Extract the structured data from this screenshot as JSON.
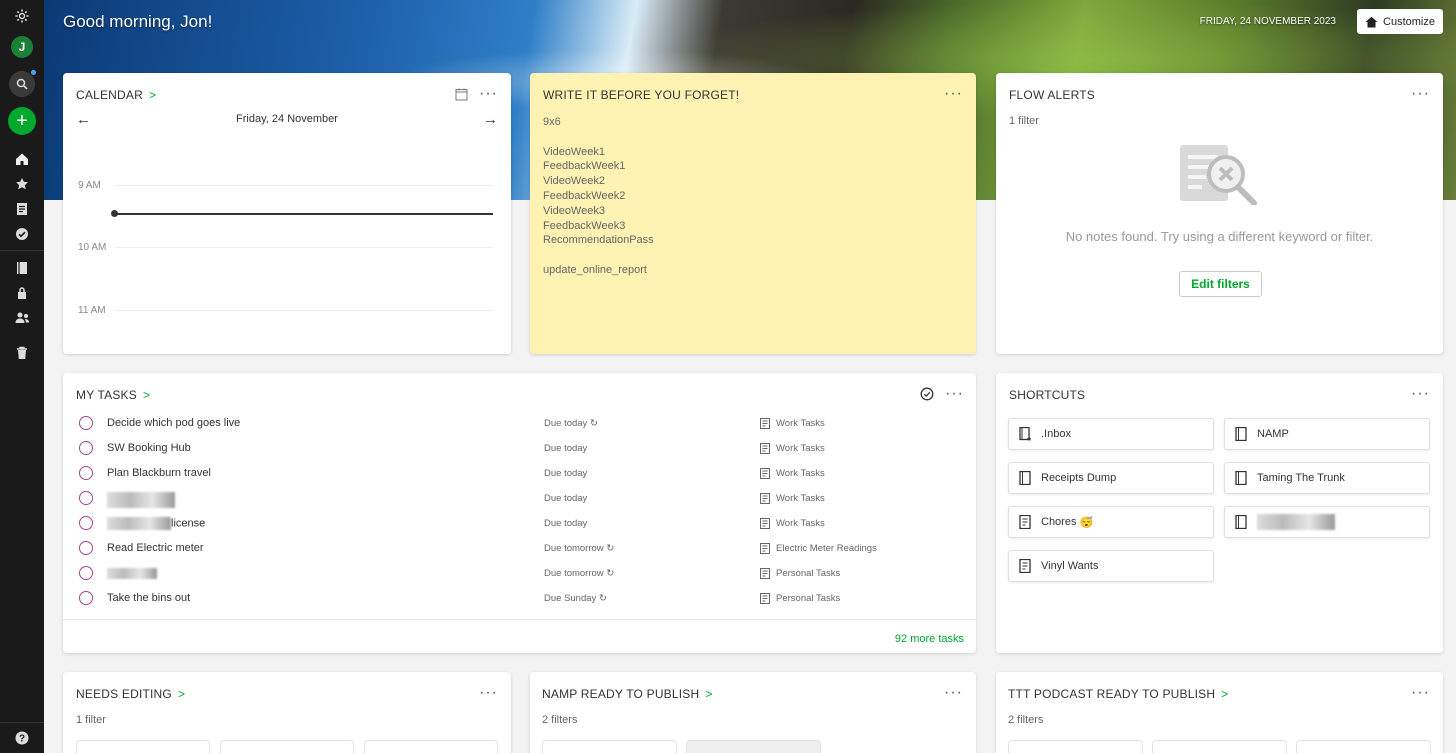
{
  "sidebar": {
    "avatar_letter": "J",
    "icons": [
      "gear-icon",
      "search-icon",
      "plus-icon",
      "home-icon",
      "star-icon",
      "note-icon",
      "check-icon",
      "notebook-icon",
      "tag-icon",
      "people-icon",
      "trash-icon",
      "help-icon"
    ]
  },
  "header": {
    "greeting": "Good morning, Jon!",
    "date": "FRIDAY, 24 NOVEMBER 2023",
    "customize_label": "Customize"
  },
  "calendar": {
    "title": "CALENDAR",
    "date": "Friday, 24 November",
    "hours": [
      "9 AM",
      "10 AM",
      "11 AM"
    ]
  },
  "scratchpad": {
    "title": "WRITE IT BEFORE YOU FORGET!",
    "lines": [
      "9x6",
      "",
      "VideoWeek1",
      "FeedbackWeek1",
      "VideoWeek2",
      "FeedbackWeek2",
      "VideoWeek3",
      "FeedbackWeek3",
      "RecommendationPass",
      "",
      "update_online_report"
    ]
  },
  "flow_alerts": {
    "title": "FLOW ALERTS",
    "filters": "1 filter",
    "empty_message": "No notes found. Try using a different keyword or filter.",
    "edit_filters_label": "Edit filters"
  },
  "tasks": {
    "title": "MY TASKS",
    "items": [
      {
        "title": "Decide which pod goes live",
        "due": "Due today",
        "recurring": true,
        "notebook": "Work Tasks"
      },
      {
        "title": "SW Booking Hub",
        "due": "Due today",
        "recurring": false,
        "notebook": "Work Tasks"
      },
      {
        "title": "Plan Blackburn travel",
        "due": "Due today",
        "recurring": false,
        "notebook": "Work Tasks"
      },
      {
        "title": "",
        "due": "Due today",
        "recurring": false,
        "notebook": "Work Tasks"
      },
      {
        "title": "license",
        "due": "Due today",
        "recurring": false,
        "notebook": "Work Tasks"
      },
      {
        "title": "Read Electric meter",
        "due": "Due tomorrow",
        "recurring": true,
        "notebook": "Electric Meter Readings"
      },
      {
        "title": "",
        "due": "Due tomorrow",
        "recurring": true,
        "notebook": "Personal Tasks"
      },
      {
        "title": "Take the bins out",
        "due": "Due Sunday",
        "recurring": true,
        "notebook": "Personal Tasks"
      }
    ],
    "more_label": "92 more tasks"
  },
  "shortcuts": {
    "title": "SHORTCUTS",
    "items": [
      {
        "label": ".Inbox",
        "icon": "notebook-star-icon"
      },
      {
        "label": "NAMP",
        "icon": "notebook-icon"
      },
      {
        "label": "Receipts Dump",
        "icon": "notebook-icon"
      },
      {
        "label": "Taming The Trunk",
        "icon": "notebook-icon"
      },
      {
        "label": "Chores",
        "emoji": "😴",
        "icon": "note-icon"
      },
      {
        "label": "",
        "icon": "notebook-icon"
      },
      {
        "label": "Vinyl Wants",
        "icon": "note-icon"
      }
    ]
  },
  "bottom_widgets": [
    {
      "title": "NEEDS EDITING",
      "filters": "1 filter"
    },
    {
      "title": "NAMP READY TO PUBLISH",
      "filters": "2 filters"
    },
    {
      "title": "TTT PODCAST READY TO PUBLISH",
      "filters": "2 filters"
    }
  ],
  "colors": {
    "accent": "#00a82d",
    "task_circle": "#a3439b",
    "note_bg": "#fff2b3",
    "sidebar": "#1a1a1a"
  }
}
